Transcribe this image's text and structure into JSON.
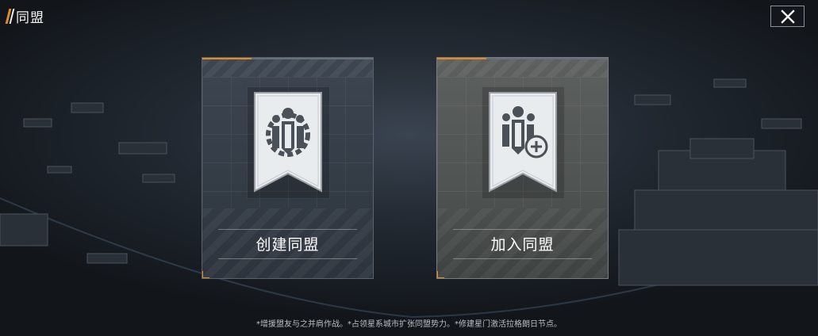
{
  "header": {
    "title": "同盟"
  },
  "close_button": {
    "icon": "close-icon"
  },
  "cards": [
    {
      "label": "创建同盟",
      "icon": "alliance-create-banner-icon"
    },
    {
      "label": "加入同盟",
      "icon": "alliance-join-banner-icon"
    }
  ],
  "footer": {
    "hint": "*增援盟友与之并肩作战。*占领星系城市扩张同盟势力。*修建星门激活拉格朗日节点。"
  },
  "colors": {
    "accent": "#e68a1e",
    "text": "#ffffff"
  }
}
